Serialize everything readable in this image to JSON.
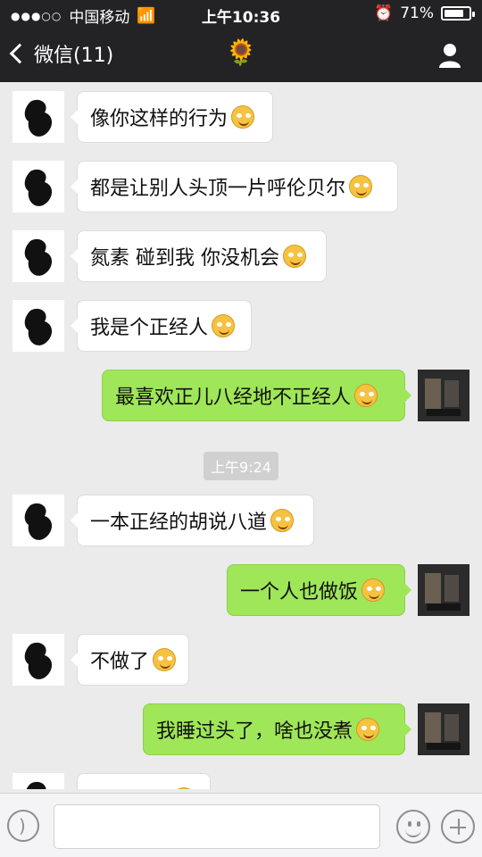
{
  "status_bar": {
    "signal": "●●●○○",
    "carrier": "中国移动",
    "time": "上午10:36",
    "battery_percent": "71%",
    "battery_level": 0.71,
    "icons": [
      "wifi-icon",
      "alarm-icon"
    ]
  },
  "header": {
    "back_label": "微信(11)",
    "title": "🌻",
    "profile_icon": "person-icon"
  },
  "messages": [
    {
      "side": "left",
      "text": "像你这样的行为"
    },
    {
      "side": "left",
      "text": "都是让别人头顶一片呼伦贝尔"
    },
    {
      "side": "left",
      "text": "氮素 碰到我 你没机会"
    },
    {
      "side": "left",
      "text": "我是个正经人"
    },
    {
      "side": "right",
      "text": "最喜欢正儿八经地不正经人"
    },
    {
      "side": "left",
      "text": "一本正经的胡说八道"
    },
    {
      "side": "right",
      "text": "一个人也做饭"
    },
    {
      "side": "left",
      "text": "不做了"
    },
    {
      "side": "right",
      "text": "我睡过头了，啥也没煮"
    },
    {
      "side": "left",
      "text": "我要确觉"
    }
  ],
  "timestamp": "上午9:24",
  "colors": {
    "header_bg": "#232326",
    "chat_bg": "#ebebeb",
    "bubble_right": "#9fe658",
    "bubble_left": "#ffffff"
  },
  "input_bar": {
    "voice_icon": "voice-icon",
    "emoji_icon": "smiley-icon",
    "plus_icon": "plus-icon",
    "placeholder": ""
  }
}
